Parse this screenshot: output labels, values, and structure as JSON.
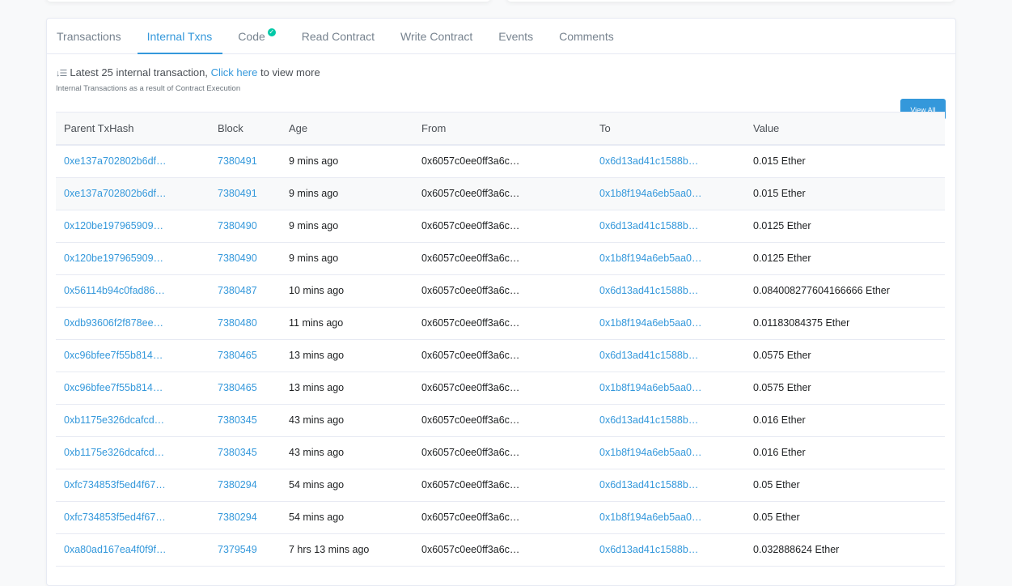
{
  "tabs": [
    {
      "label": "Transactions",
      "active": false,
      "verified": false
    },
    {
      "label": "Internal Txns",
      "active": true,
      "verified": false
    },
    {
      "label": "Code",
      "active": false,
      "verified": true
    },
    {
      "label": "Read Contract",
      "active": false,
      "verified": false
    },
    {
      "label": "Write Contract",
      "active": false,
      "verified": false
    },
    {
      "label": "Events",
      "active": false,
      "verified": false
    },
    {
      "label": "Comments",
      "active": false,
      "verified": false
    }
  ],
  "info": {
    "prefix": "Latest 25 internal transaction,",
    "link": "Click here",
    "suffix": "to view more",
    "subtitle": "Internal Transactions as a result of Contract Execution",
    "view_all": "View All"
  },
  "table": {
    "headers": {
      "hash": "Parent TxHash",
      "block": "Block",
      "age": "Age",
      "from": "From",
      "to": "To",
      "value": "Value"
    },
    "rows": [
      {
        "hash": "0xe137a702802b6df…",
        "block": "7380491",
        "age": "9 mins ago",
        "from": "0x6057c0ee0ff3a6c…",
        "to": "0x6d13ad41c1588b…",
        "value": "0.015 Ether"
      },
      {
        "hash": "0xe137a702802b6df…",
        "block": "7380491",
        "age": "9 mins ago",
        "from": "0x6057c0ee0ff3a6c…",
        "to": "0x1b8f194a6eb5aa0…",
        "value": "0.015 Ether"
      },
      {
        "hash": "0x120be197965909…",
        "block": "7380490",
        "age": "9 mins ago",
        "from": "0x6057c0ee0ff3a6c…",
        "to": "0x6d13ad41c1588b…",
        "value": "0.0125 Ether"
      },
      {
        "hash": "0x120be197965909…",
        "block": "7380490",
        "age": "9 mins ago",
        "from": "0x6057c0ee0ff3a6c…",
        "to": "0x1b8f194a6eb5aa0…",
        "value": "0.0125 Ether"
      },
      {
        "hash": "0x56114b94c0fad86…",
        "block": "7380487",
        "age": "10 mins ago",
        "from": "0x6057c0ee0ff3a6c…",
        "to": "0x6d13ad41c1588b…",
        "value": "0.084008277604166666 Ether"
      },
      {
        "hash": "0xdb93606f2f878ee…",
        "block": "7380480",
        "age": "11 mins ago",
        "from": "0x6057c0ee0ff3a6c…",
        "to": "0x1b8f194a6eb5aa0…",
        "value": "0.01183084375 Ether"
      },
      {
        "hash": "0xc96bfee7f55b814…",
        "block": "7380465",
        "age": "13 mins ago",
        "from": "0x6057c0ee0ff3a6c…",
        "to": "0x6d13ad41c1588b…",
        "value": "0.0575 Ether"
      },
      {
        "hash": "0xc96bfee7f55b814…",
        "block": "7380465",
        "age": "13 mins ago",
        "from": "0x6057c0ee0ff3a6c…",
        "to": "0x1b8f194a6eb5aa0…",
        "value": "0.0575 Ether"
      },
      {
        "hash": "0xb1175e326dcafcd…",
        "block": "7380345",
        "age": "43 mins ago",
        "from": "0x6057c0ee0ff3a6c…",
        "to": "0x6d13ad41c1588b…",
        "value": "0.016 Ether"
      },
      {
        "hash": "0xb1175e326dcafcd…",
        "block": "7380345",
        "age": "43 mins ago",
        "from": "0x6057c0ee0ff3a6c…",
        "to": "0x1b8f194a6eb5aa0…",
        "value": "0.016 Ether"
      },
      {
        "hash": "0xfc734853f5ed4f67…",
        "block": "7380294",
        "age": "54 mins ago",
        "from": "0x6057c0ee0ff3a6c…",
        "to": "0x6d13ad41c1588b…",
        "value": "0.05 Ether"
      },
      {
        "hash": "0xfc734853f5ed4f67…",
        "block": "7380294",
        "age": "54 mins ago",
        "from": "0x6057c0ee0ff3a6c…",
        "to": "0x1b8f194a6eb5aa0…",
        "value": "0.05 Ether"
      },
      {
        "hash": "0xa80ad167ea4f0f9f…",
        "block": "7379549",
        "age": "7 hrs 13 mins ago",
        "from": "0x6057c0ee0ff3a6c…",
        "to": "0x6d13ad41c1588b…",
        "value": "0.032888624 Ether"
      }
    ]
  }
}
